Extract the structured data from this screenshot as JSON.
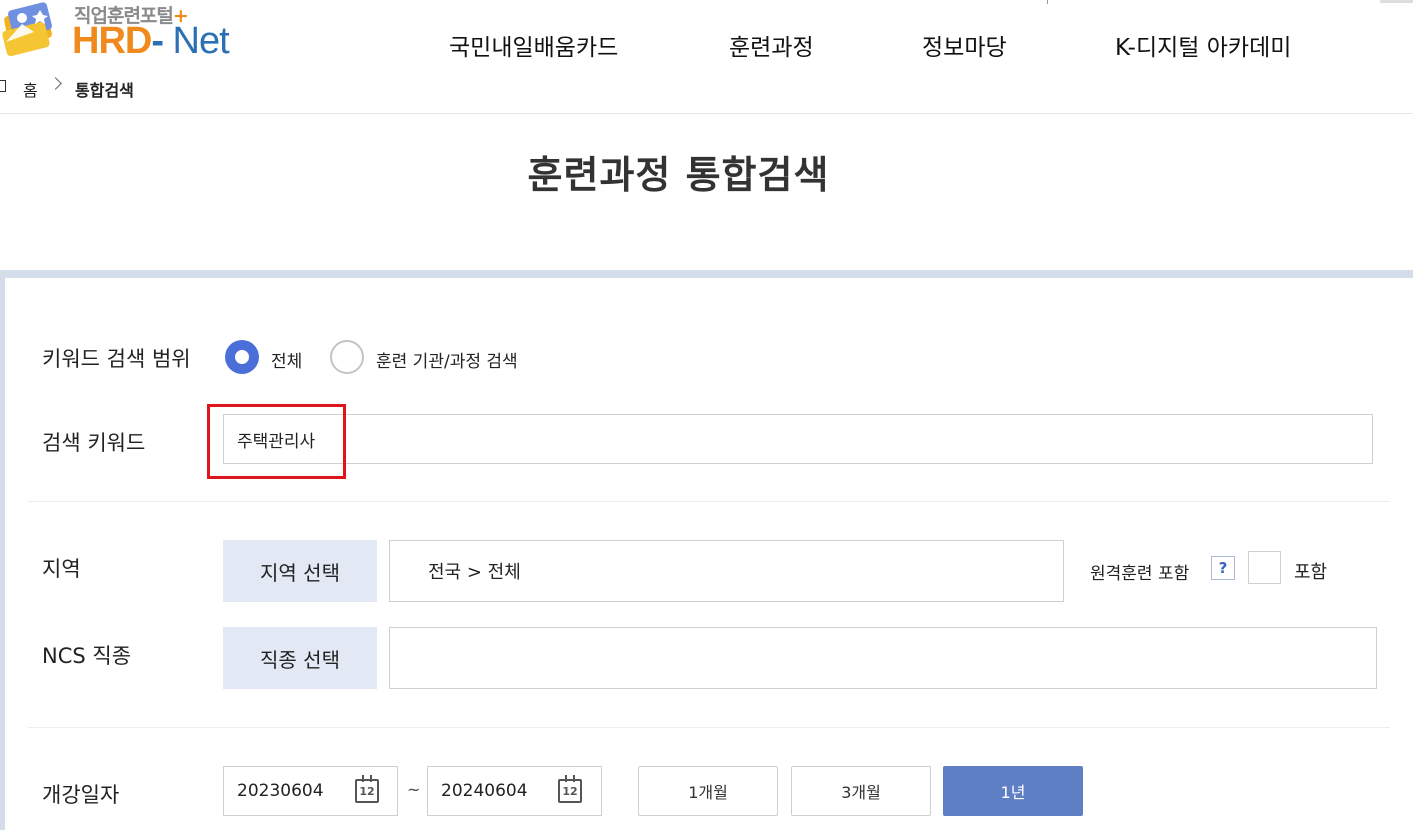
{
  "header": {
    "logo_sub": "직업훈련포털",
    "logo_plus": "+",
    "logo_main_hrd": "HRD",
    "logo_main_dash": "-",
    "logo_main_net": " Net",
    "nav": [
      {
        "label": "국민내일배움카드"
      },
      {
        "label": "훈련과정"
      },
      {
        "label": "정보마당"
      },
      {
        "label": "K-디지털 아카데미"
      }
    ]
  },
  "breadcrumb": {
    "home": "홈",
    "current": "통합검색"
  },
  "page_title": "훈련과정 통합검색",
  "search": {
    "keyword_scope_label": "키워드 검색 범위",
    "scope_options": [
      {
        "label": "전체",
        "selected": true
      },
      {
        "label": "훈련 기관/과정 검색",
        "selected": false
      }
    ],
    "keyword_label": "검색 키워드",
    "keyword_value": "주택관리사",
    "region_label": "지역",
    "region_button": "지역 선택",
    "region_value": "전국 > 전체",
    "remote_label": "원격훈련 포함",
    "remote_help": "?",
    "remote_include_label": "포함",
    "remote_checked": false,
    "ncs_label": "NCS 직종",
    "ncs_button": "직종 선택",
    "ncs_value": "",
    "start_date_label": "개강일자",
    "date_from": "20230604",
    "date_to": "20240604",
    "date_separator": "~",
    "calendar_glyph": "12",
    "periods": [
      {
        "label": "1개월",
        "active": false
      },
      {
        "label": "3개월",
        "active": false
      },
      {
        "label": "1년",
        "active": true
      }
    ]
  },
  "colors": {
    "accent": "#4a6fd8",
    "active_button": "#5f7fc5",
    "select_button_bg": "#e3e9f4",
    "panel_border": "#d5dcea",
    "highlight": "#e0151b",
    "logo_orange": "#f08a1c",
    "logo_blue": "#2b6fb5"
  }
}
